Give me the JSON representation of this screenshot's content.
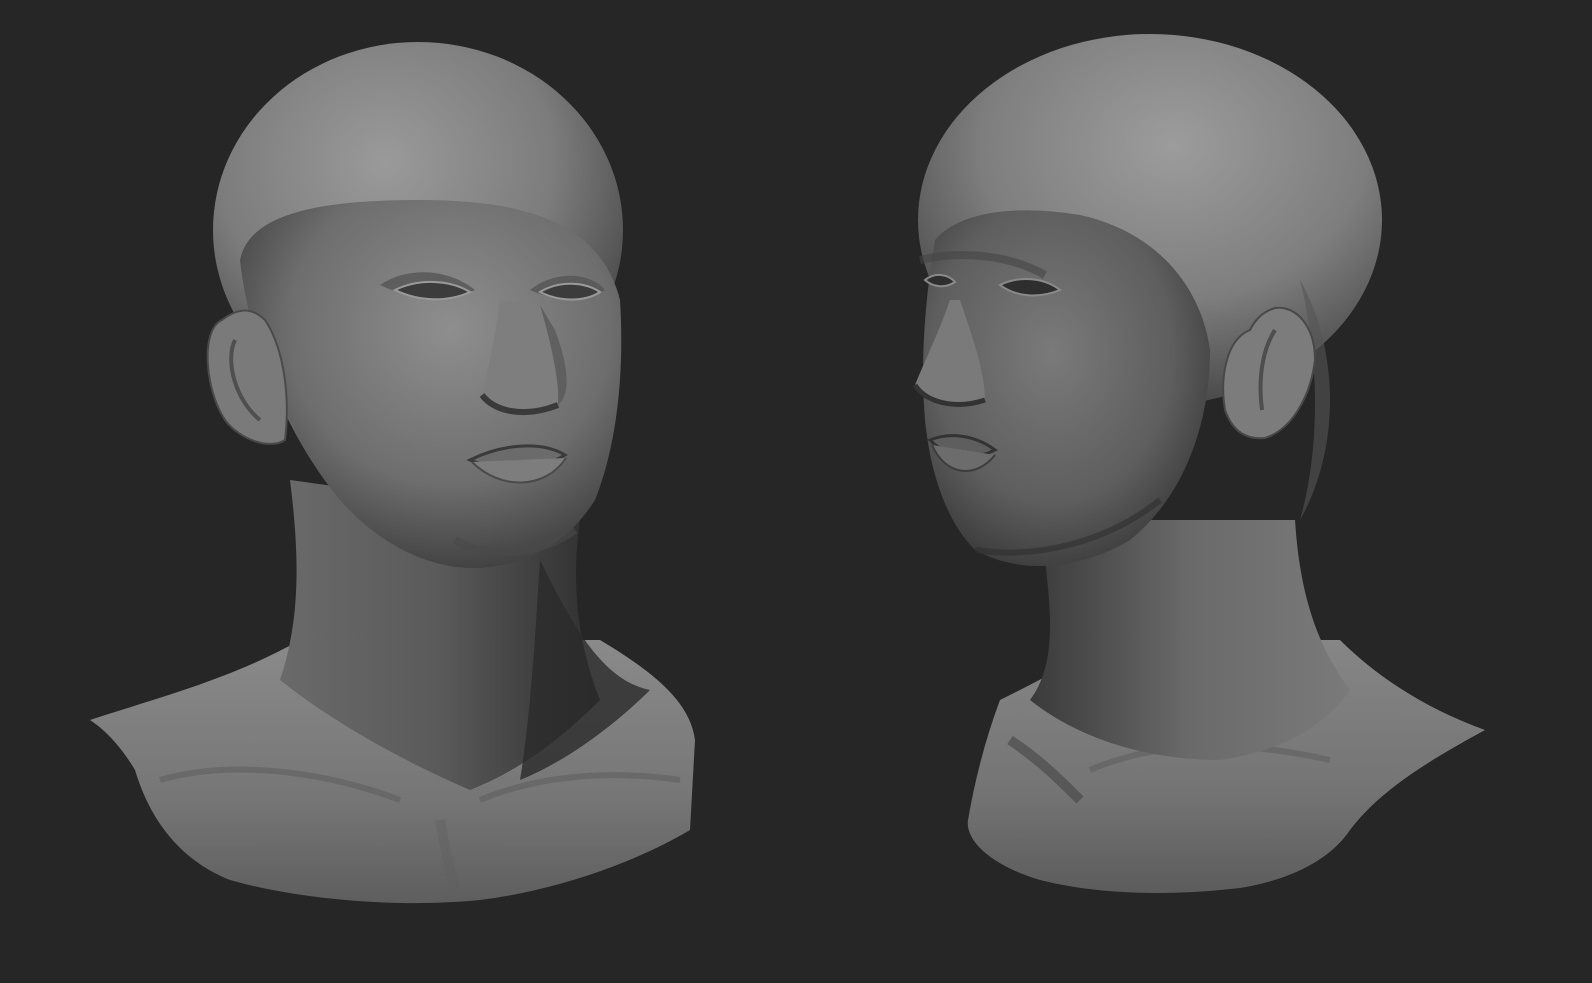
{
  "scene": {
    "background_color": "#262626",
    "material_color": "#7a7a7a",
    "views": [
      {
        "name": "front-three-quarter-view"
      },
      {
        "name": "side-three-quarter-view"
      }
    ]
  }
}
